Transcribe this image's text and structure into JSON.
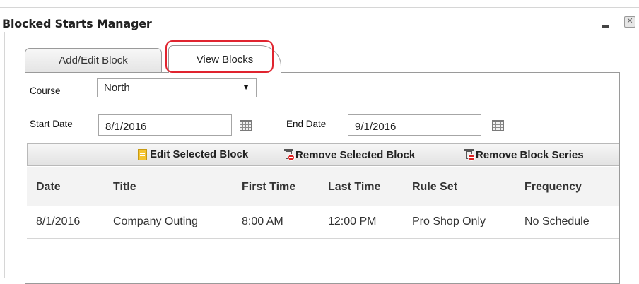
{
  "window": {
    "title": "Blocked Starts Manager"
  },
  "tabs": [
    {
      "label": "Add/Edit Block"
    },
    {
      "label": "View Blocks"
    }
  ],
  "filters": {
    "course_label": "Course",
    "course_value": "North",
    "start_date_label": "Start Date",
    "start_date_value": "8/1/2016",
    "end_date_label": "End Date",
    "end_date_value": "9/1/2016"
  },
  "toolbar": {
    "edit_label": "Edit Selected Block",
    "remove_label": "Remove Selected Block",
    "remove_series_label": "Remove Block Series"
  },
  "grid": {
    "columns": [
      "Date",
      "Title",
      "First Time",
      "Last Time",
      "Rule Set",
      "Frequency"
    ],
    "rows": [
      [
        "8/1/2016",
        "Company Outing",
        "8:00 AM",
        "12:00 PM",
        "Pro Shop Only",
        "No Schedule"
      ]
    ]
  },
  "icons": {
    "minimize": "minimize-icon",
    "close": "close-icon",
    "calendar": "calendar-icon",
    "edit": "document-icon",
    "remove": "trash-delete-icon"
  },
  "colors": {
    "highlight": "#e0242f"
  }
}
